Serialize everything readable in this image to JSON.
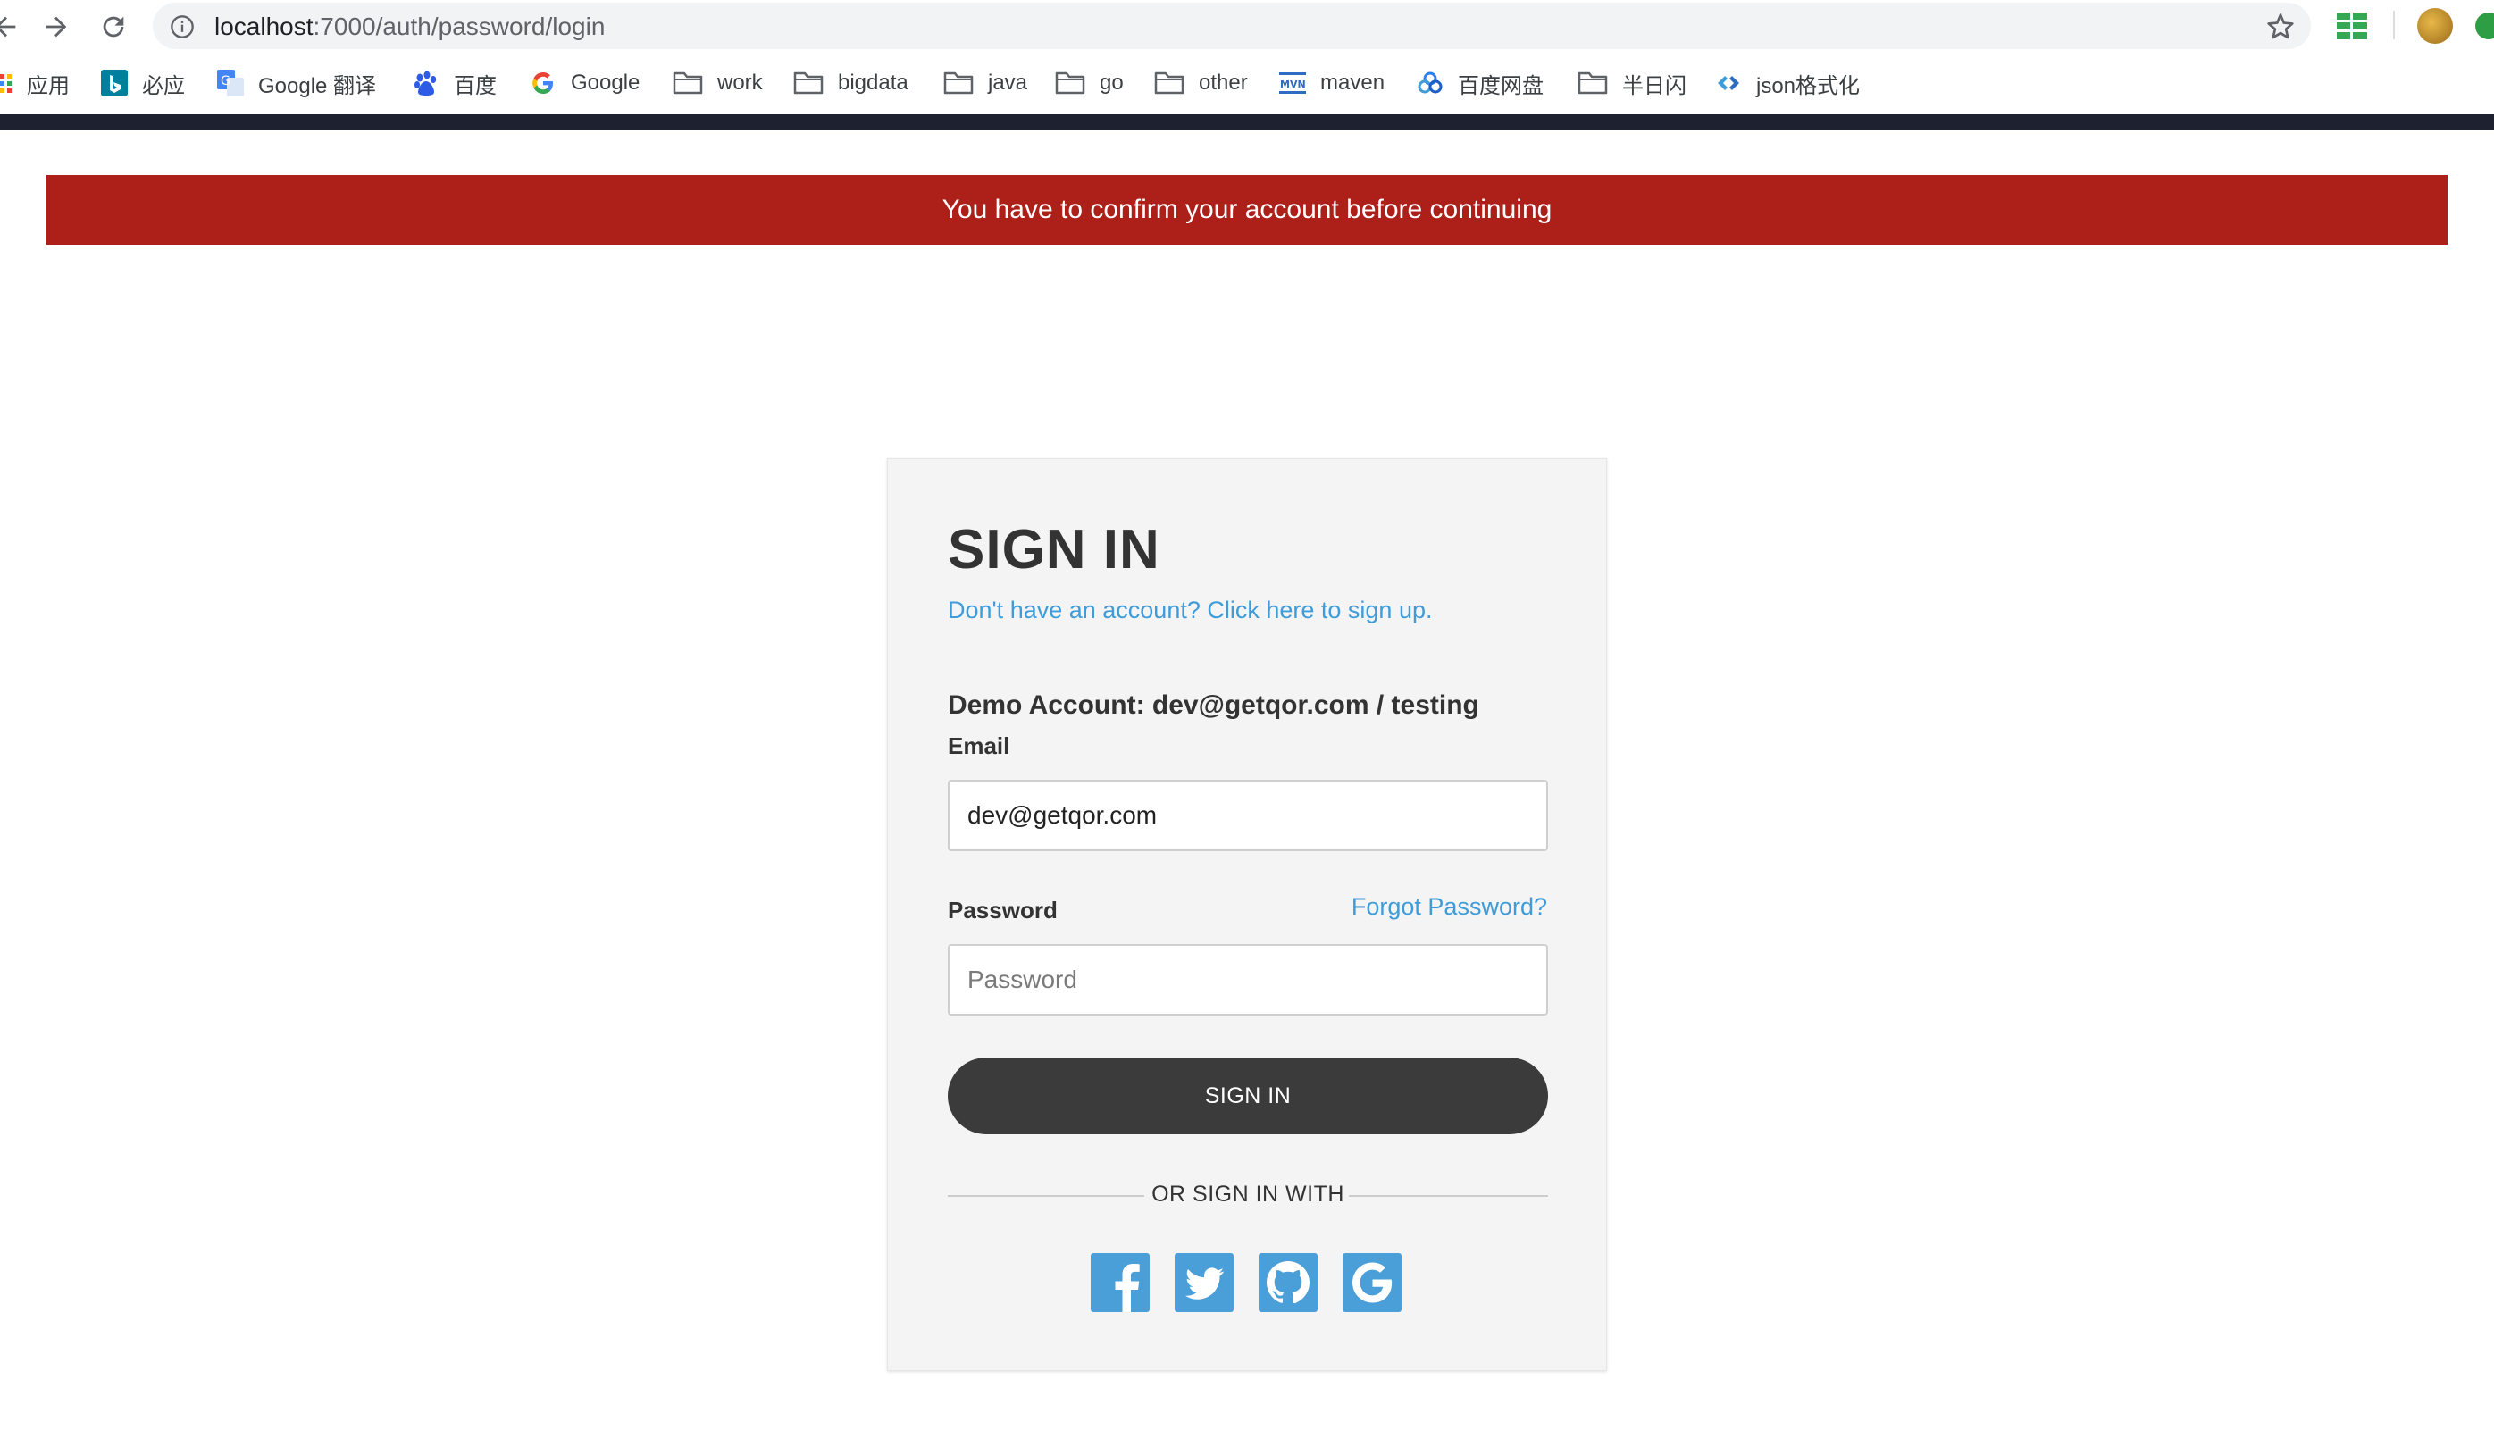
{
  "browser": {
    "url_host": "localhost",
    "url_path": ":7000/auth/password/login"
  },
  "bookmarks": {
    "apps": "应用",
    "bing": "必应",
    "google_translate": "Google 翻译",
    "baidu": "百度",
    "google": "Google",
    "work": "work",
    "bigdata": "bigdata",
    "java": "java",
    "go": "go",
    "other": "other",
    "maven": "maven",
    "baidu_pan": "百度网盘",
    "banrishan": "半日闪",
    "json": "json格式化"
  },
  "alert": {
    "message": "You have to confirm your account before continuing",
    "color": "#ad2019"
  },
  "signin": {
    "title": "SIGN IN",
    "signup_link": "Don't have an account? Click here to sign up.",
    "demo_account": "Demo Account: dev@getqor.com / testing",
    "email_label": "Email",
    "email_value": "dev@getqor.com",
    "password_label": "Password",
    "forgot_link": "Forgot Password?",
    "password_placeholder": "Password",
    "button_label": "SIGN IN",
    "divider": "OR SIGN IN WITH",
    "social_icons": [
      "facebook-icon",
      "twitter-icon",
      "github-icon",
      "google-icon"
    ],
    "link_color": "#3f9cd9",
    "button_color": "#3b3b3b",
    "social_color": "#4a9fd8"
  }
}
